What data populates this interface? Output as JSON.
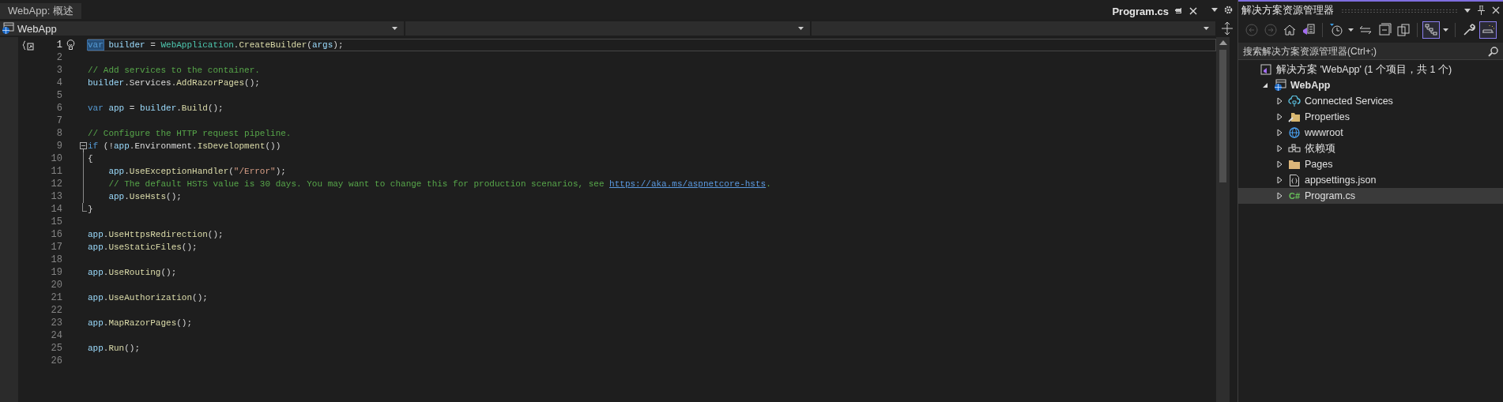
{
  "doc_tabs": [
    {
      "label": "WebApp: 概述",
      "selected": false
    },
    {
      "label": "Program.cs",
      "selected": true
    }
  ],
  "nav_bar": {
    "project": "WebApp"
  },
  "code": [
    {
      "number": "1",
      "current": true,
      "tokens": [
        {
          "kind": "keyword_selected",
          "text": "var"
        },
        {
          "kind": "var",
          "text": " builder"
        },
        {
          "kind": "punct",
          "text": " = "
        },
        {
          "kind": "type",
          "text": "WebApplication"
        },
        {
          "kind": "punct",
          "text": "."
        },
        {
          "kind": "method",
          "text": "CreateBuilder"
        },
        {
          "kind": "punct",
          "text": "("
        },
        {
          "kind": "var",
          "text": "args"
        },
        {
          "kind": "punct",
          "text": ");"
        }
      ]
    },
    {
      "number": "2",
      "current": false
    },
    {
      "number": "3",
      "current": false,
      "tokens": [
        {
          "kind": "comment",
          "text": "// Add services to the container."
        }
      ]
    },
    {
      "number": "4",
      "current": false,
      "tokens": [
        {
          "kind": "var",
          "text": "builder"
        },
        {
          "kind": "punct",
          "text": "."
        },
        {
          "kind": "prop",
          "text": "Services"
        },
        {
          "kind": "punct",
          "text": "."
        },
        {
          "kind": "method",
          "text": "AddRazorPages"
        },
        {
          "kind": "punct",
          "text": "();"
        }
      ]
    },
    {
      "number": "5",
      "current": false
    },
    {
      "number": "6",
      "current": false,
      "tokens": [
        {
          "kind": "keyword",
          "text": "var"
        },
        {
          "kind": "var",
          "text": " app"
        },
        {
          "kind": "punct",
          "text": " = "
        },
        {
          "kind": "var",
          "text": "builder"
        },
        {
          "kind": "punct",
          "text": "."
        },
        {
          "kind": "method",
          "text": "Build"
        },
        {
          "kind": "punct",
          "text": "();"
        }
      ]
    },
    {
      "number": "7",
      "current": false
    },
    {
      "number": "8",
      "current": false,
      "tokens": [
        {
          "kind": "comment",
          "text": "// Configure the HTTP request pipeline."
        }
      ]
    },
    {
      "number": "9",
      "current": false,
      "expanded": true,
      "tokens": [
        {
          "kind": "keyword",
          "text": "if"
        },
        {
          "kind": "punct",
          "text": " (!"
        },
        {
          "kind": "var",
          "text": "app"
        },
        {
          "kind": "punct",
          "text": "."
        },
        {
          "kind": "prop",
          "text": "Environment"
        },
        {
          "kind": "punct",
          "text": "."
        },
        {
          "kind": "method",
          "text": "IsDevelopment"
        },
        {
          "kind": "punct",
          "text": "())"
        }
      ],
      "children": [
        {
          "number": "10",
          "current": false,
          "tokens": [
            {
              "kind": "punct",
              "text": "{"
            }
          ]
        },
        {
          "number": "11",
          "current": false,
          "tokens": [
            {
              "kind": "var",
              "text": "    app"
            },
            {
              "kind": "punct",
              "text": "."
            },
            {
              "kind": "method",
              "text": "UseExceptionHandler"
            },
            {
              "kind": "punct",
              "text": "("
            },
            {
              "kind": "string",
              "text": "\"/Error\""
            },
            {
              "kind": "punct",
              "text": ");"
            }
          ]
        },
        {
          "number": "12",
          "current": false,
          "tokens": [
            {
              "kind": "comment",
              "text": "    // The default HSTS value is 30 days. You may want to change this for production scenarios, see "
            },
            {
              "kind": "link",
              "text": "https://aka.ms/aspnetcore-hsts"
            },
            {
              "kind": "comment",
              "text": "."
            }
          ]
        },
        {
          "number": "13",
          "current": false,
          "tokens": [
            {
              "kind": "var",
              "text": "    app"
            },
            {
              "kind": "punct",
              "text": "."
            },
            {
              "kind": "method",
              "text": "UseHsts"
            },
            {
              "kind": "punct",
              "text": "();"
            }
          ]
        },
        {
          "number": "14",
          "current": false,
          "tokens": [
            {
              "kind": "punct",
              "text": "}"
            }
          ]
        }
      ]
    },
    {
      "number": "15",
      "current": false
    },
    {
      "number": "16",
      "current": false,
      "tokens": [
        {
          "kind": "var",
          "text": "app"
        },
        {
          "kind": "punct",
          "text": "."
        },
        {
          "kind": "method",
          "text": "UseHttpsRedirection"
        },
        {
          "kind": "punct",
          "text": "();"
        }
      ]
    },
    {
      "number": "17",
      "current": false,
      "tokens": [
        {
          "kind": "var",
          "text": "app"
        },
        {
          "kind": "punct",
          "text": "."
        },
        {
          "kind": "method",
          "text": "UseStaticFiles"
        },
        {
          "kind": "punct",
          "text": "();"
        }
      ]
    },
    {
      "number": "18",
      "current": false
    },
    {
      "number": "19",
      "current": false,
      "tokens": [
        {
          "kind": "var",
          "text": "app"
        },
        {
          "kind": "punct",
          "text": "."
        },
        {
          "kind": "method",
          "text": "UseRouting"
        },
        {
          "kind": "punct",
          "text": "();"
        }
      ]
    },
    {
      "number": "20",
      "current": false
    },
    {
      "number": "21",
      "current": false,
      "tokens": [
        {
          "kind": "var",
          "text": "app"
        },
        {
          "kind": "punct",
          "text": "."
        },
        {
          "kind": "method",
          "text": "UseAuthorization"
        },
        {
          "kind": "punct",
          "text": "();"
        }
      ]
    },
    {
      "number": "22",
      "current": false
    },
    {
      "number": "23",
      "current": false,
      "tokens": [
        {
          "kind": "var",
          "text": "app"
        },
        {
          "kind": "punct",
          "text": "."
        },
        {
          "kind": "method",
          "text": "MapRazorPages"
        },
        {
          "kind": "punct",
          "text": "();"
        }
      ]
    },
    {
      "number": "24",
      "current": false
    },
    {
      "number": "25",
      "current": false,
      "tokens": [
        {
          "kind": "var",
          "text": "app"
        },
        {
          "kind": "punct",
          "text": "."
        },
        {
          "kind": "method",
          "text": "Run"
        },
        {
          "kind": "punct",
          "text": "();"
        }
      ]
    },
    {
      "number": "26",
      "current": false
    }
  ],
  "solution_explorer": {
    "title": "解决方案资源管理器",
    "toolbar": [
      {
        "kind": "back",
        "disabled": true,
        "selected": false
      },
      {
        "kind": "forward",
        "disabled": true,
        "selected": false
      },
      {
        "kind": "home",
        "disabled": false,
        "selected": false
      },
      {
        "kind": "switch",
        "disabled": false,
        "selected": false
      },
      {
        "kind": "history",
        "disabled": false,
        "selected": false
      },
      {
        "kind": "sync",
        "disabled": false,
        "selected": false
      },
      {
        "kind": "collapse",
        "disabled": false,
        "selected": false
      },
      {
        "kind": "copies",
        "disabled": false,
        "selected": false
      },
      {
        "kind": "tree",
        "disabled": false,
        "selected": true
      },
      {
        "kind": "wrench",
        "disabled": false,
        "selected": false
      },
      {
        "kind": "preview",
        "disabled": false,
        "selected": true
      }
    ],
    "search": {
      "placeholder": "搜索解决方案资源管理器(Ctrl+;)"
    },
    "tree": [
      {
        "label": "解决方案 'WebApp' (1 个项目，共 1 个)",
        "kind": "solution",
        "selected": false,
        "children": [
          {
            "label": "WebApp",
            "kind": "project",
            "expanded": true,
            "selected": false,
            "children": [
              {
                "label": "Connected Services",
                "kind": "connected",
                "expanded": false,
                "selected": false
              },
              {
                "label": "Properties",
                "kind": "properties",
                "expanded": false,
                "selected": false
              },
              {
                "label": "wwwroot",
                "kind": "globe",
                "expanded": false,
                "selected": false
              },
              {
                "label": "依赖项",
                "kind": "dependencies",
                "expanded": false,
                "selected": false
              },
              {
                "label": "Pages",
                "kind": "folder",
                "expanded": false,
                "selected": false
              },
              {
                "label": "appsettings.json",
                "kind": "json",
                "expanded": false,
                "selected": false
              },
              {
                "label": "Program.cs",
                "kind": "csharp",
                "badge": "C#",
                "expanded": false,
                "selected": true
              }
            ]
          }
        ]
      }
    ]
  }
}
